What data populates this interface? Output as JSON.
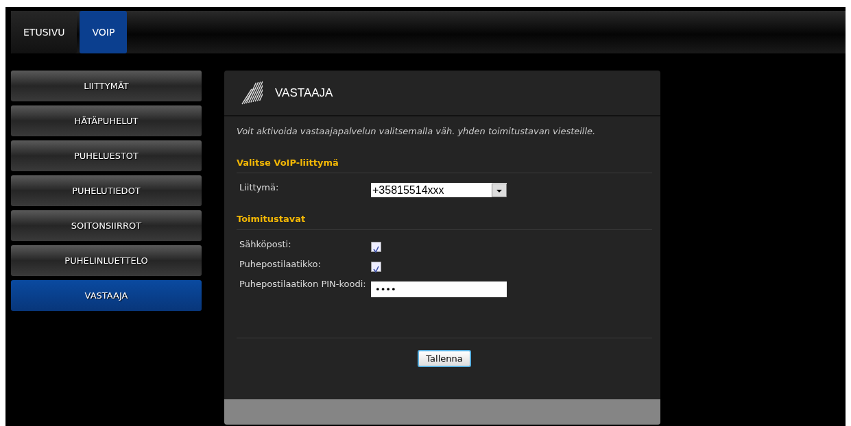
{
  "top_tabs": [
    {
      "label": "ETUSIVU",
      "selected": false
    },
    {
      "label": "VOIP",
      "selected": true
    }
  ],
  "sidebar": {
    "items": [
      {
        "label": "LIITTYMÄT",
        "selected": false
      },
      {
        "label": "HÄTÄPUHELUT",
        "selected": false
      },
      {
        "label": "PUHELUESTOT",
        "selected": false
      },
      {
        "label": "PUHELUTIEDOT",
        "selected": false
      },
      {
        "label": "SOITONSIIRROT",
        "selected": false
      },
      {
        "label": "PUHELINLUETTELO",
        "selected": false
      },
      {
        "label": "VASTAAJA",
        "selected": true
      }
    ]
  },
  "panel": {
    "title": "VASTAAJA",
    "intro": "Voit aktivoida vastaajapalvelun valitsemalla väh. yhden toimitustavan viesteille.",
    "sections": [
      {
        "heading": "Valitse VoIP-liittymä",
        "fields": [
          {
            "kind": "select",
            "label": "Liittymä:",
            "value": "+35815514xxx"
          }
        ]
      },
      {
        "heading": "Toimitustavat",
        "fields": [
          {
            "kind": "checkbox",
            "label": "Sähköposti:",
            "checked": true
          },
          {
            "kind": "checkbox",
            "label": "Puhepostilaatikko:",
            "checked": true
          },
          {
            "kind": "password",
            "label": "Puhepostilaatikon PIN-koodi:",
            "value": "••••"
          }
        ]
      }
    ],
    "save_button": "Tallenna"
  }
}
